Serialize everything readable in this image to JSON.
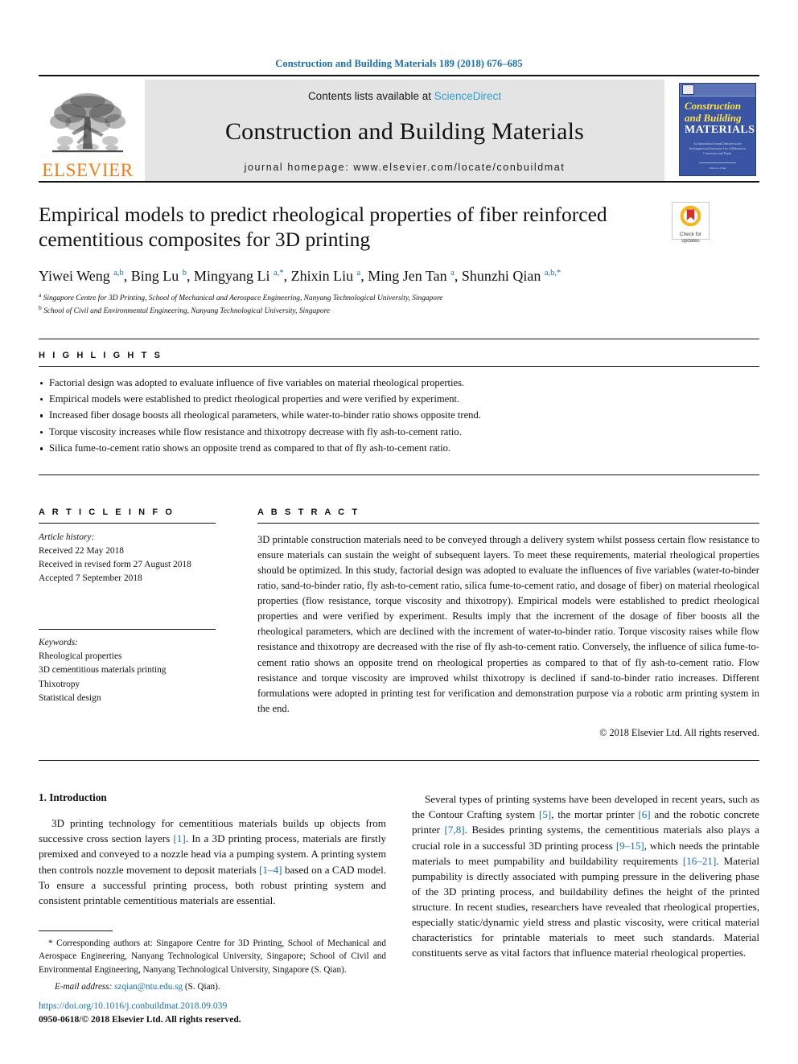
{
  "running_head": "Construction and Building Materials 189 (2018) 676–685",
  "masthead": {
    "publisher_name": "ELSEVIER",
    "contents_prefix": "Contents lists available at ",
    "contents_link": "ScienceDirect",
    "journal_name": "Construction and Building Materials",
    "homepage": "journal homepage: www.elsevier.com/locate/conbuildmat",
    "cover": {
      "line1": "Construction",
      "line2": "and Building",
      "line3": "MATERIALS",
      "subtitle": "An International Journal Dedicated to the Investigation and Innovative Use of Materials in Construction and Repair",
      "footer": "Editor-in-Chief"
    }
  },
  "article": {
    "title": "Empirical models to predict rheological properties of fiber reinforced cementitious composites for 3D printing",
    "authors_html": "Yiwei Weng <sup>a,b</sup>, Bing Lu <sup>b</sup>, Mingyang Li <sup>a,*</sup>, Zhixin Liu <sup>a</sup>, Ming Jen Tan <sup>a</sup>, Shunzhi Qian <sup>a,b,*</sup>",
    "affiliation_a": "Singapore Centre for 3D Printing, School of Mechanical and Aerospace Engineering, Nanyang Technological University, Singapore",
    "affiliation_b": "School of Civil and Environmental Engineering, Nanyang Technological University, Singapore",
    "crossmark_line1": "Check for",
    "crossmark_line2": "updates"
  },
  "highlights": {
    "heading": "H I G H L I G H T S",
    "items": [
      "Factorial design was adopted to evaluate influence of five variables on material rheological properties.",
      "Empirical models were established to predict rheological properties and were verified by experiment.",
      "Increased fiber dosage boosts all rheological parameters, while water-to-binder ratio shows opposite trend.",
      "Torque viscosity increases while flow resistance and thixotropy decrease with fly ash-to-cement ratio.",
      "Silica fume-to-cement ratio shows an opposite trend as compared to that of fly ash-to-cement ratio."
    ]
  },
  "article_info": {
    "heading": "A R T I C L E   I N F O",
    "history_label": "Article history:",
    "history": [
      "Received 22 May 2018",
      "Received in revised form 27 August 2018",
      "Accepted 7 September 2018"
    ],
    "keywords_label": "Keywords:",
    "keywords": [
      "Rheological properties",
      "3D cementitious materials printing",
      "Thixotropy",
      "Statistical design"
    ]
  },
  "abstract": {
    "heading": "A B S T R A C T",
    "text": "3D printable construction materials need to be conveyed through a delivery system whilst possess certain flow resistance to ensure materials can sustain the weight of subsequent layers. To meet these requirements, material rheological properties should be optimized. In this study, factorial design was adopted to evaluate the influences of five variables (water-to-binder ratio, sand-to-binder ratio, fly ash-to-cement ratio, silica fume-to-cement ratio, and dosage of fiber) on material rheological properties (flow resistance, torque viscosity and thixotropy). Empirical models were established to predict rheological properties and were verified by experiment. Results imply that the increment of the dosage of fiber boosts all the rheological parameters, which are declined with the increment of water-to-binder ratio. Torque viscosity raises while flow resistance and thixotropy are decreased with the rise of fly ash-to-cement ratio. Conversely, the influence of silica fume-to-cement ratio shows an opposite trend on rheological properties as compared to that of fly ash-to-cement ratio. Flow resistance and torque viscosity are improved whilst thixotropy is declined if sand-to-binder ratio increases. Different formulations were adopted in printing test for verification and demonstration purpose via a robotic arm printing system in the end.",
    "copyright": "© 2018 Elsevier Ltd. All rights reserved."
  },
  "body": {
    "section_title": "1. Introduction",
    "left_para_html": "3D printing technology for cementitious materials builds up objects from successive cross section layers <span class=\"lnk\">[1]</span>. In a 3D printing process, materials are firstly premixed and conveyed to a nozzle head via a pumping system. A printing system then controls nozzle movement to deposit materials <span class=\"lnk\">[1–4]</span> based on a CAD model. To ensure a successful printing process, both robust printing system and consistent printable cementitious materials are essential.",
    "right_para_html": "Several types of printing systems have been developed in recent years, such as the Contour Crafting system <span class=\"lnk\">[5]</span>, the mortar printer <span class=\"lnk\">[6]</span> and the robotic concrete printer <span class=\"lnk\">[7,8]</span>. Besides printing systems, the cementitious materials also plays a crucial role in a successful 3D printing process <span class=\"lnk\">[9–15]</span>, which needs the printable materials to meet pumpability and buildability requirements <span class=\"lnk\">[16–21]</span>. Material pumpability is directly associated with pumping pressure in the delivering phase of the 3D printing process, and buildability defines the height of the printed structure. In recent studies, researchers have revealed that rheological properties, especially static/dynamic yield stress and plastic viscosity, were critical material characteristics for printable materials to meet such standards. Material constituents serve as vital factors that influence material rheological properties."
  },
  "footnote": {
    "text": "* Corresponding authors at: Singapore Centre for 3D Printing, School of Mechanical and Aerospace Engineering, Nanyang Technological University, Singapore; School of Civil and Environmental Engineering, Nanyang Technological University, Singapore (S. Qian).",
    "email_label": "E-mail address:",
    "email": "szqian@ntu.edu.sg",
    "email_suffix": "(S. Qian)."
  },
  "footer": {
    "doi": "https://doi.org/10.1016/j.conbuildmat.2018.09.039",
    "issn": "0950-0618/© 2018 Elsevier Ltd. All rights reserved."
  },
  "colors": {
    "link_blue": "#1a6ea8",
    "sciencedirect_blue": "#2f9fd0",
    "elsevier_orange": "#ef7d1a",
    "cover_blue": "#3a55a4",
    "cover_yellow": "#ffe14d",
    "masthead_gray": "#e4e4e4"
  }
}
